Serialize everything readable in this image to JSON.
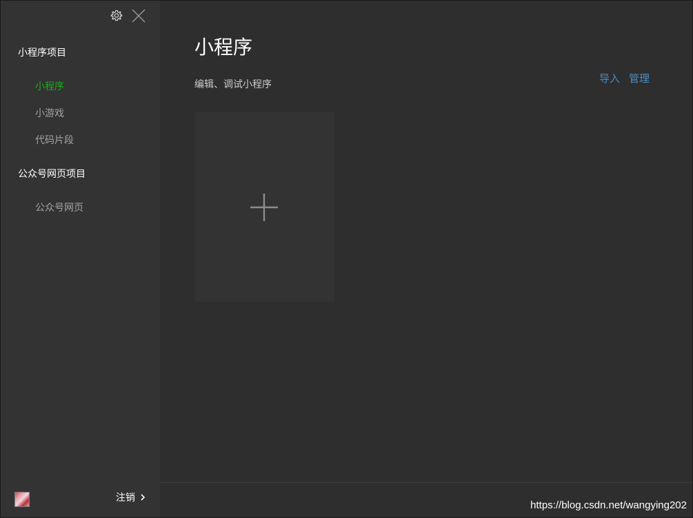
{
  "sidebar": {
    "sections": [
      {
        "title": "小程序项目",
        "items": [
          {
            "label": "小程序",
            "active": true
          },
          {
            "label": "小游戏",
            "active": false
          },
          {
            "label": "代码片段",
            "active": false
          }
        ]
      },
      {
        "title": "公众号网页项目",
        "items": [
          {
            "label": "公众号网页",
            "active": false
          }
        ]
      }
    ],
    "footer": {
      "logout_label": "注销"
    }
  },
  "main": {
    "title": "小程序",
    "subtitle": "编辑、调试小程序",
    "actions": {
      "import_label": "导入",
      "manage_label": "管理"
    }
  },
  "watermark": "https://blog.csdn.net/wangying202",
  "icons": {
    "settings": "gear-icon",
    "close": "close-icon",
    "add": "plus-icon",
    "logout_arrow": "chevron-right-icon"
  },
  "colors": {
    "accent_active": "#1aad19",
    "link": "#4c8bbf",
    "sidebar_bg": "#333333",
    "main_bg": "#2e2e2e"
  }
}
